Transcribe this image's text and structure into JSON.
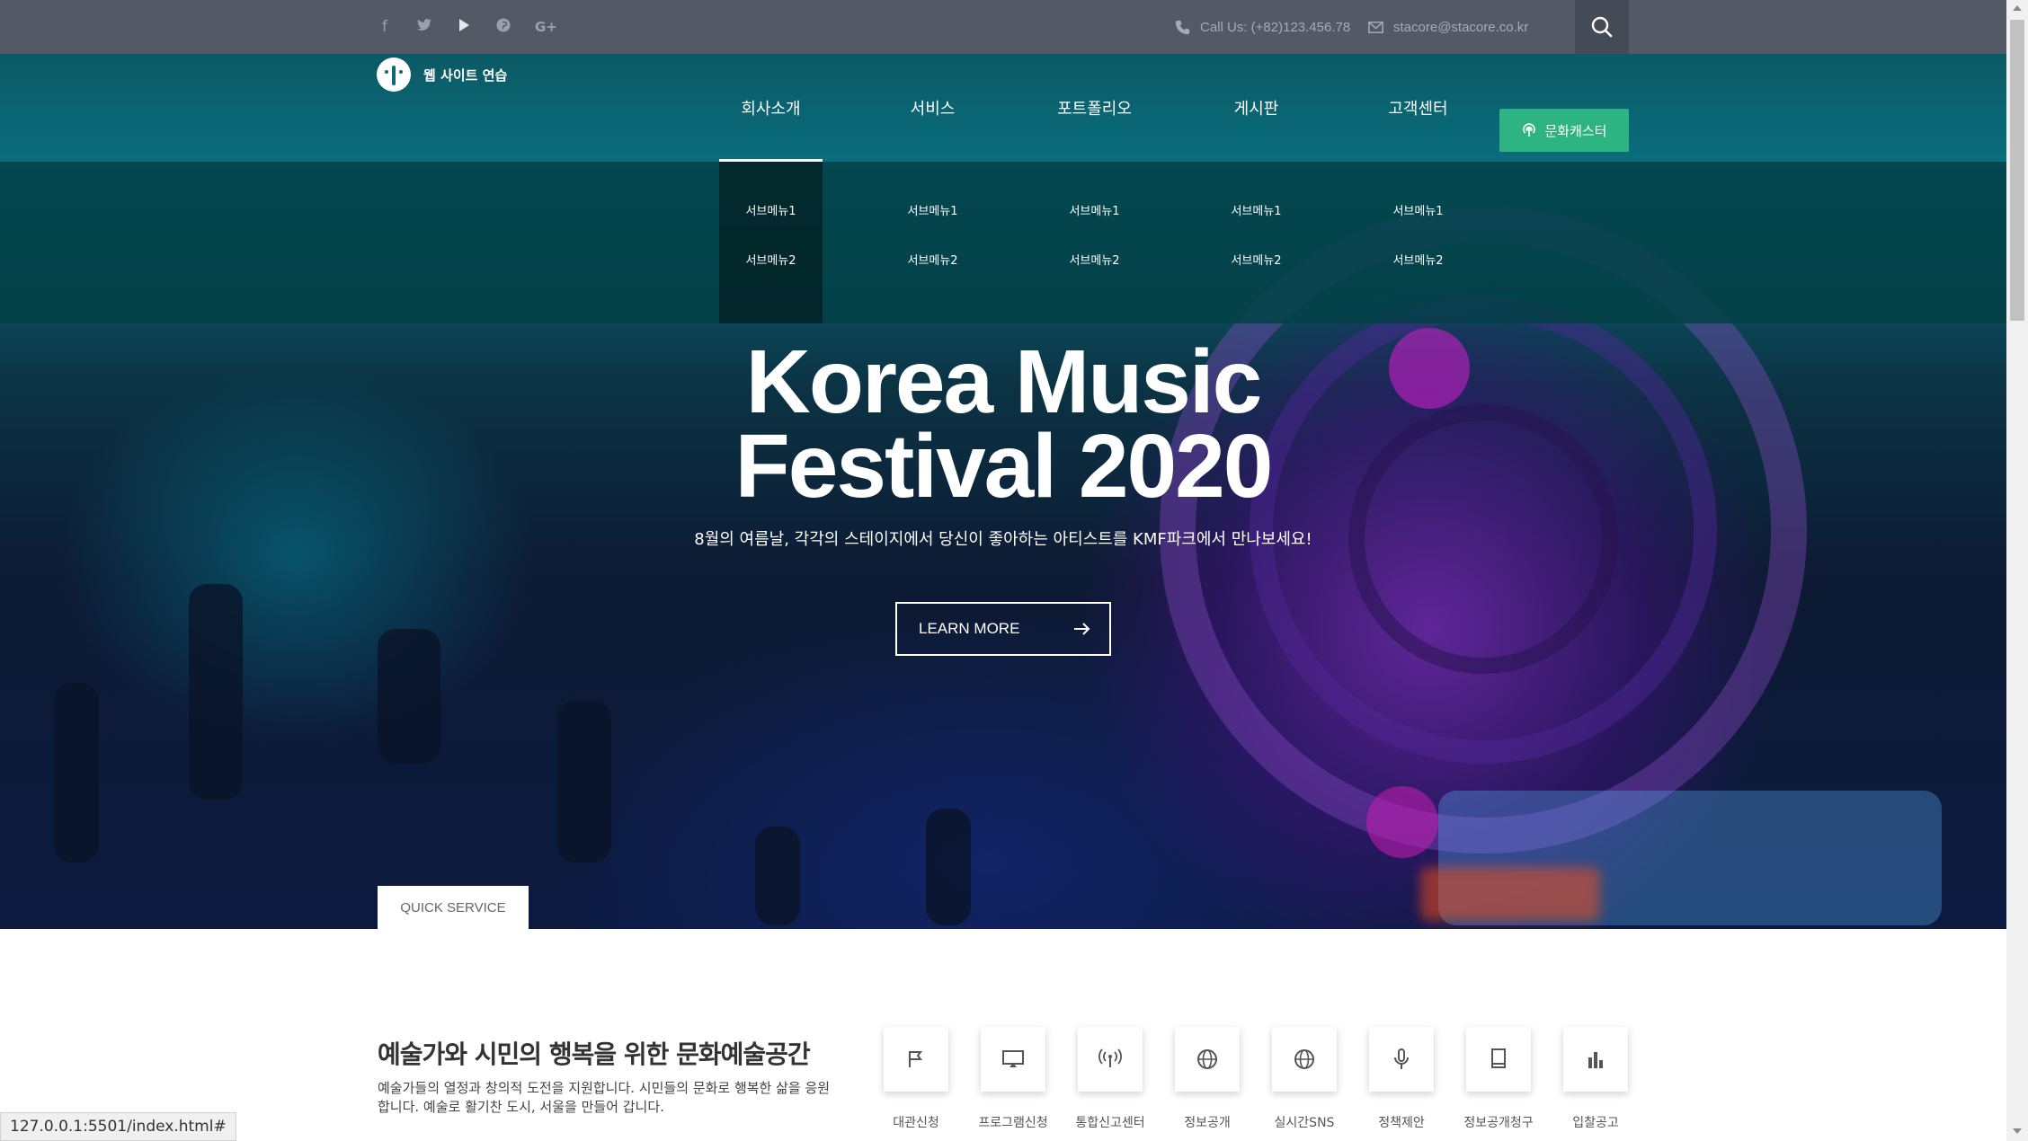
{
  "topbar": {
    "social": [
      {
        "name": "facebook-icon",
        "glyph": "f"
      },
      {
        "name": "twitter-icon",
        "glyph": "🐦"
      },
      {
        "name": "youtube-icon",
        "glyph": "▶"
      },
      {
        "name": "pinterest-icon",
        "glyph": "℗"
      },
      {
        "name": "google-plus-icon",
        "glyph": "G+"
      }
    ],
    "phone": "Call Us: (+82)123.456.78",
    "email": "stacore@stacore.co.kr"
  },
  "header": {
    "logo_text": "웹 사이트 연습",
    "nav": [
      "회사소개",
      "서비스",
      "포트폴리오",
      "게시판",
      "고객센터"
    ],
    "cta_label": "문화캐스터",
    "submenus": [
      [
        "서브메뉴1",
        "서브메뉴2"
      ],
      [
        "서브메뉴1",
        "서브메뉴2"
      ],
      [
        "서브메뉴1",
        "서브메뉴2"
      ],
      [
        "서브메뉴1",
        "서브메뉴2"
      ],
      [
        "서브메뉴1",
        "서브메뉴2"
      ]
    ]
  },
  "hero": {
    "title_line1": "Korea Music",
    "title_line2": "Festival 2020",
    "subtitle": "8월의 여름날, 각각의 스테이지에서 당신이 좋아하는 아티스트를 KMF파크에서 만나보세요!",
    "button_label": "LEARN MORE",
    "quick_tab": "QUICK SERVICE"
  },
  "content": {
    "title": "예술가와 시민의 행복을 위한 문화예술공간",
    "desc": "예술가들의 열정과 창의적 도전을 지원합니다. 시민들의 문화로 행복한 삶을 응원 합니다. 예술로 활기찬 도시, 서울을 만들어 갑니다.",
    "quick": [
      {
        "label": "대관신청",
        "icon": "flag-icon"
      },
      {
        "label": "프로그램신청",
        "icon": "monitor-icon"
      },
      {
        "label": "통합신고센터",
        "icon": "antenna-icon"
      },
      {
        "label": "정보공개",
        "icon": "globe-icon"
      },
      {
        "label": "실시간SNS",
        "icon": "globe-icon"
      },
      {
        "label": "정책제안",
        "icon": "microphone-icon"
      },
      {
        "label": "정보공개청구",
        "icon": "book-icon"
      },
      {
        "label": "입찰공고",
        "icon": "bar-chart-icon"
      }
    ]
  },
  "status_url": "127.0.0.1:5501/index.html#",
  "colors": {
    "accent": "#2eb382",
    "topbar": "#535a66"
  }
}
